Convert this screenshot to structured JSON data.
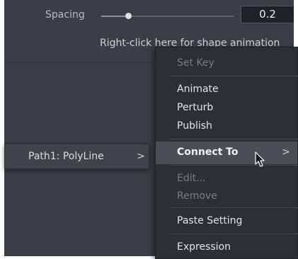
{
  "inspector": {
    "spacing_label": "Spacing",
    "spacing_value": "0.2",
    "spacing_level": 0.2,
    "hint_text": "Right-click here for shape animation"
  },
  "path_row": {
    "label": "Path1: PolyLine",
    "chevron": ">"
  },
  "menu": {
    "set_key": "Set Key",
    "animate": "Animate",
    "perturb": "Perturb",
    "publish": "Publish",
    "connect_to": "Connect To",
    "connect_to_chevron": ">",
    "edit": "Edit...",
    "remove": "Remove",
    "paste_setting": "Paste Setting",
    "expression": "Expression"
  },
  "colors": {
    "panel_bg": "#3a3f45",
    "menu_bg": "#2c3035",
    "highlight": "#4a4f56",
    "disabled_text": "#777c82"
  },
  "icons": {
    "cursor": "mouse-pointer-icon",
    "submenu": "chevron-right-icon"
  }
}
